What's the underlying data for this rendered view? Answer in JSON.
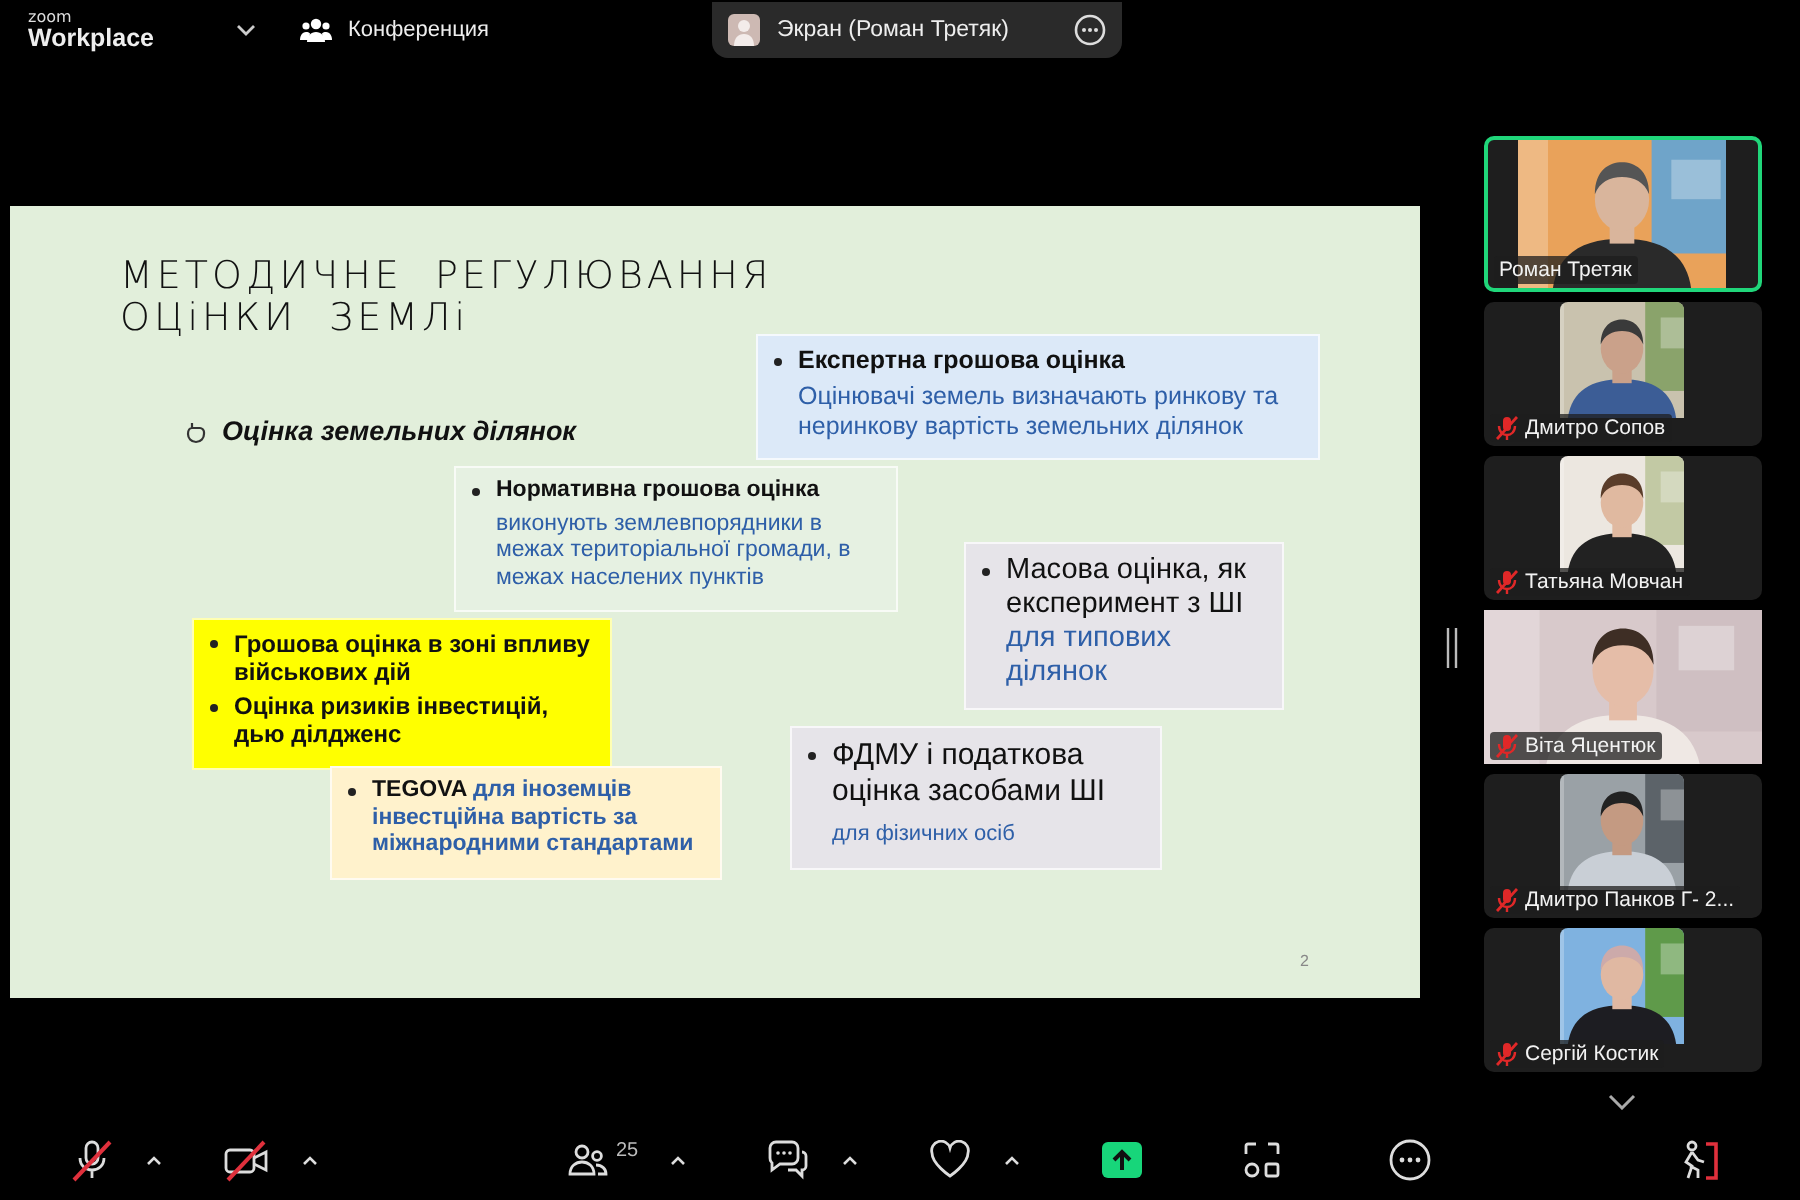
{
  "top_bar": {
    "logo_top": "zoom",
    "logo_bottom": "Workplace",
    "meeting": "Конференция",
    "share_label": "Экран (Роман Третяк)"
  },
  "slide": {
    "title_lines": [
      "МЕТОДИЧНЕ  РЕГУЛЮВАННЯ",
      "ОЦіНКИ  ЗЕМЛі"
    ],
    "subtitle": "Оцінка земельних ділянок",
    "page": "2",
    "boxes": [
      {
        "color": "#dce9f8",
        "lines": [
          {
            "kind": "item",
            "parts": [
              {
                "text": "Експертна грошова оцінка",
                "kind": "head"
              }
            ]
          },
          {
            "kind": "sub",
            "parts": [
              {
                "text": "Оцінювачі земель визначають ринкову та неринкову вартість земельних ділянок",
                "kind": "note"
              }
            ]
          }
        ]
      },
      {
        "color": "#e6f1e2",
        "lines": [
          {
            "kind": "item",
            "parts": [
              {
                "text": "Нормативна грошова оцінка",
                "kind": "head"
              }
            ]
          },
          {
            "kind": "sub",
            "parts": [
              {
                "text": "виконують землевпорядники в межах  територіальної громади, в межах населених пунктів",
                "kind": "note"
              }
            ]
          }
        ]
      },
      {
        "color": "#e6e4e9",
        "lines": [
          {
            "kind": "item",
            "parts": [
              {
                "text": "Масова оцінка, як експеримент з ШІ",
                "kind": "plain"
              },
              {
                "text": " для типових ділянок",
                "kind": "note"
              }
            ]
          }
        ]
      },
      {
        "color": "#ffff00",
        "lines": [
          {
            "kind": "item",
            "parts": [
              {
                "text": "Грошова оцінка в зоні впливу військових дій",
                "kind": "head"
              }
            ]
          },
          {
            "kind": "item",
            "parts": [
              {
                "text": "Оцінка ризиків інвестицій, дью ділдженс",
                "kind": "head"
              }
            ]
          }
        ]
      },
      {
        "color": "#fff2cc",
        "lines": [
          {
            "kind": "item",
            "parts": [
              {
                "text": "TEGOVA",
                "kind": "head"
              },
              {
                "text": " для іноземців інвестційна вартість за міжнародними стандартами",
                "kind": "note-bold"
              }
            ]
          }
        ]
      },
      {
        "color": "#e6e4e9",
        "lines": [
          {
            "kind": "item",
            "parts": [
              {
                "text": "ФДМУ і податкова оцінка засобами ШІ",
                "kind": "plain"
              }
            ]
          },
          {
            "kind": "sub",
            "parts": [
              {
                "text": "для фізичних осіб",
                "kind": "note"
              }
            ]
          }
        ]
      }
    ]
  },
  "participants": [
    {
      "name": "Роман Третяк",
      "muted": false,
      "speaking": true,
      "kind": "wide"
    },
    {
      "name": "Дмитро Сопов",
      "muted": true,
      "speaking": false,
      "kind": "portrait"
    },
    {
      "name": "Татьяна Мовчан",
      "muted": true,
      "speaking": false,
      "kind": "portrait"
    },
    {
      "name": "Віта Яцентюк",
      "muted": true,
      "speaking": false,
      "kind": "full"
    },
    {
      "name": "Дмитро Панков Г- 2...",
      "muted": true,
      "speaking": false,
      "kind": "portrait"
    },
    {
      "name": "Сергій Костик",
      "muted": true,
      "speaking": false,
      "kind": "portrait"
    }
  ],
  "toolbar": [
    {
      "kind": "mic",
      "off": true,
      "caret": true
    },
    {
      "kind": "video",
      "off": true,
      "caret": true
    },
    {
      "kind": "participants",
      "count": "25",
      "caret": true
    },
    {
      "kind": "chat",
      "caret": true
    },
    {
      "kind": "reactions",
      "caret": true
    },
    {
      "kind": "share",
      "caret": false
    },
    {
      "kind": "apps",
      "caret": false
    },
    {
      "kind": "more",
      "caret": false
    },
    {
      "kind": "leave",
      "caret": false
    }
  ]
}
